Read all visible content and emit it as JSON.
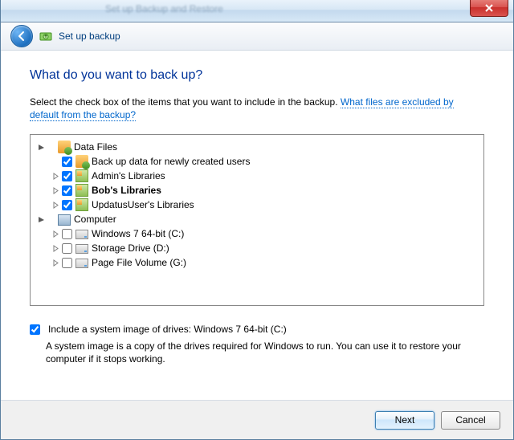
{
  "titlebar": {
    "blurred_text": "Set up Backup and Restore"
  },
  "header": {
    "title": "Set up backup"
  },
  "page": {
    "heading": "What do you want to back up?",
    "intro_prefix": "Select the check box of the items that you want to include in the backup. ",
    "intro_link": "What files are excluded by default from the backup?"
  },
  "tree": {
    "dataFiles": {
      "label": "Data Files",
      "children": [
        {
          "label": "Back up data for newly created users",
          "checked": true,
          "expandable": false,
          "bold": false
        },
        {
          "label": "Admin's Libraries",
          "checked": true,
          "expandable": true,
          "bold": false
        },
        {
          "label": "Bob's Libraries",
          "checked": true,
          "expandable": true,
          "bold": true
        },
        {
          "label": "UpdatusUser's Libraries",
          "checked": true,
          "expandable": true,
          "bold": false
        }
      ]
    },
    "computer": {
      "label": "Computer",
      "children": [
        {
          "label": "Windows 7 64-bit (C:)",
          "checked": false,
          "expandable": true
        },
        {
          "label": "Storage Drive (D:)",
          "checked": false,
          "expandable": true
        },
        {
          "label": "Page File Volume (G:)",
          "checked": false,
          "expandable": true
        }
      ]
    }
  },
  "systemImage": {
    "checked": true,
    "label": "Include a system image of drives: Windows 7 64-bit (C:)",
    "description": "A system image is a copy of the drives required for Windows to run. You can use it to restore your computer if it stops working."
  },
  "buttons": {
    "next": "Next",
    "cancel": "Cancel"
  }
}
